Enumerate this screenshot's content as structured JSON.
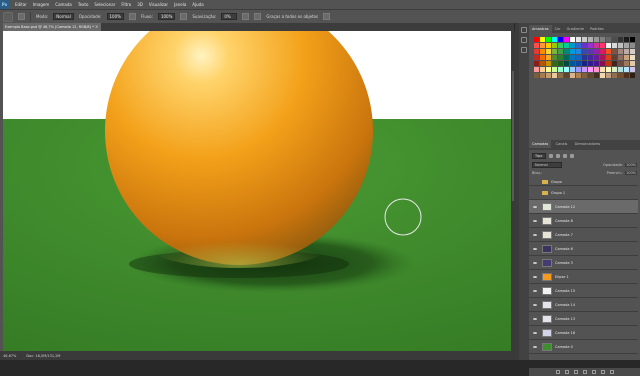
{
  "app": {
    "logo": "Ps"
  },
  "menu": [
    "Editar",
    "Imagem",
    "Camada",
    "Texto",
    "Selecionar",
    "Filtro",
    "3D",
    "Visualizar",
    "Janela",
    "Ajuda"
  ],
  "options_bar": {
    "mode_label": "Modo:",
    "mode_value": "Normal",
    "opacity_label": "Opacidade:",
    "opacity_value": "100%",
    "flow_label": "Fluxo:",
    "flow_value": "100%",
    "smoothing_label": "Suavização:",
    "smoothing_value": "0%",
    "sample_all_label": "Graças a todos os objetos"
  },
  "document": {
    "tab_title": "Exemplo Base.psd @ 46,7% (Camada 12, RGB/8) *",
    "close_glyph": "×",
    "zoom": "46,67%",
    "doc_info": "Doc: 18,0M/131,2M"
  },
  "swatches_panel": {
    "tabs": [
      "Amostras",
      "Cor",
      "Gradiente",
      "Padrões"
    ],
    "active_tab": 0,
    "colors": [
      "#ff0000",
      "#ffff00",
      "#00ff00",
      "#00ffff",
      "#0000ff",
      "#ff00ff",
      "#ffffff",
      "#e6e6e6",
      "#cccccc",
      "#b3b3b3",
      "#999999",
      "#808080",
      "#666666",
      "#4d4d4d",
      "#333333",
      "#1a1a1a",
      "#000000",
      "#ff4d4d",
      "#ff9933",
      "#ffcc00",
      "#99cc00",
      "#33cc66",
      "#00cc99",
      "#0099cc",
      "#3366cc",
      "#6633cc",
      "#9933cc",
      "#cc3399",
      "#ff3366",
      "#f2f2f2",
      "#d9d9d9",
      "#bfbfbf",
      "#a6a6a6",
      "#8c8c8c",
      "#e53935",
      "#fb8c00",
      "#fdd835",
      "#7cb342",
      "#43a047",
      "#00897b",
      "#039be5",
      "#1e88e5",
      "#3949ab",
      "#5e35b1",
      "#8e24aa",
      "#d81b60",
      "#f4511e",
      "#795548",
      "#a1887f",
      "#bcaaa4",
      "#d7ccc8",
      "#c62828",
      "#ef6c00",
      "#f9a825",
      "#558b2f",
      "#2e7d32",
      "#00695c",
      "#0277bd",
      "#1565c0",
      "#283593",
      "#4527a0",
      "#6a1b9a",
      "#ad1457",
      "#d84315",
      "#5d4037",
      "#8d6e63",
      "#c8a27a",
      "#efdfc4",
      "#8e1b1b",
      "#b35900",
      "#c79100",
      "#33691e",
      "#1b5e20",
      "#004d40",
      "#01579b",
      "#0d47a1",
      "#1a237e",
      "#311b92",
      "#4a148c",
      "#880e4f",
      "#bf360c",
      "#3e2723",
      "#6d4c41",
      "#a0785a",
      "#e0c9a6",
      "#ff9999",
      "#ffcc99",
      "#ffff99",
      "#ccff99",
      "#99ffcc",
      "#99ffff",
      "#99ccff",
      "#9999ff",
      "#cc99ff",
      "#ff99ff",
      "#ff99cc",
      "#ffe0b2",
      "#fff9c4",
      "#dcedc8",
      "#b2dfdb",
      "#b3e5fc",
      "#d1c4e9",
      "#7b5e3c",
      "#a67c52",
      "#c69c6d",
      "#e6c89c",
      "#8b6d4a",
      "#5c4630",
      "#d9b38c",
      "#b08050",
      "#806040",
      "#604830",
      "#403020",
      "#f0d8b0",
      "#c0a080",
      "#907050",
      "#705030",
      "#503020",
      "#302010"
    ]
  },
  "layers_panel": {
    "tabs": [
      "Camadas",
      "Canais",
      "Demarcadores"
    ],
    "active_tab": 0,
    "filter_label": "Tipo",
    "blend_mode": "Normal",
    "opacity_label": "Opacidade:",
    "opacity_value": "100%",
    "lock_label": "Bloq.:",
    "fill_label": "Preench.:",
    "fill_value": "100%",
    "layers": [
      {
        "kind": "group",
        "name": "Grupo",
        "visible": false,
        "selected": false,
        "thumb": "#d6b24c"
      },
      {
        "kind": "folder",
        "name": "Grupo 1",
        "visible": false,
        "selected": false,
        "thumb": "#d6b24c"
      },
      {
        "kind": "layer",
        "name": "Camada 12",
        "visible": true,
        "selected": true,
        "thumb": "#dfe7d6"
      },
      {
        "kind": "layer",
        "name": "Camada 8",
        "visible": true,
        "selected": false,
        "thumb": "#e8e4d8"
      },
      {
        "kind": "layer",
        "name": "Camada 7",
        "visible": true,
        "selected": false,
        "thumb": "#e8e4d8"
      },
      {
        "kind": "layer",
        "name": "Camada 6",
        "visible": true,
        "selected": false,
        "thumb": "#39345e"
      },
      {
        "kind": "layer",
        "name": "Camada 3",
        "visible": true,
        "selected": false,
        "thumb": "#423c72"
      },
      {
        "kind": "layer",
        "name": "Elipse 1",
        "visible": true,
        "selected": false,
        "thumb": "#f39a1f"
      },
      {
        "kind": "layer",
        "name": "Camada 15",
        "visible": true,
        "selected": false,
        "thumb": "#f1f1f1"
      },
      {
        "kind": "layer",
        "name": "Camada 14",
        "visible": true,
        "selected": false,
        "thumb": "#e4e4ec"
      },
      {
        "kind": "layer",
        "name": "Camada 13",
        "visible": true,
        "selected": false,
        "thumb": "#e4e4ec"
      },
      {
        "kind": "layer",
        "name": "Camada 16",
        "visible": true,
        "selected": false,
        "thumb": "#d2d4e8"
      },
      {
        "kind": "layer",
        "name": "Camada 0",
        "visible": true,
        "selected": false,
        "thumb": "#3f8f2f"
      }
    ]
  }
}
